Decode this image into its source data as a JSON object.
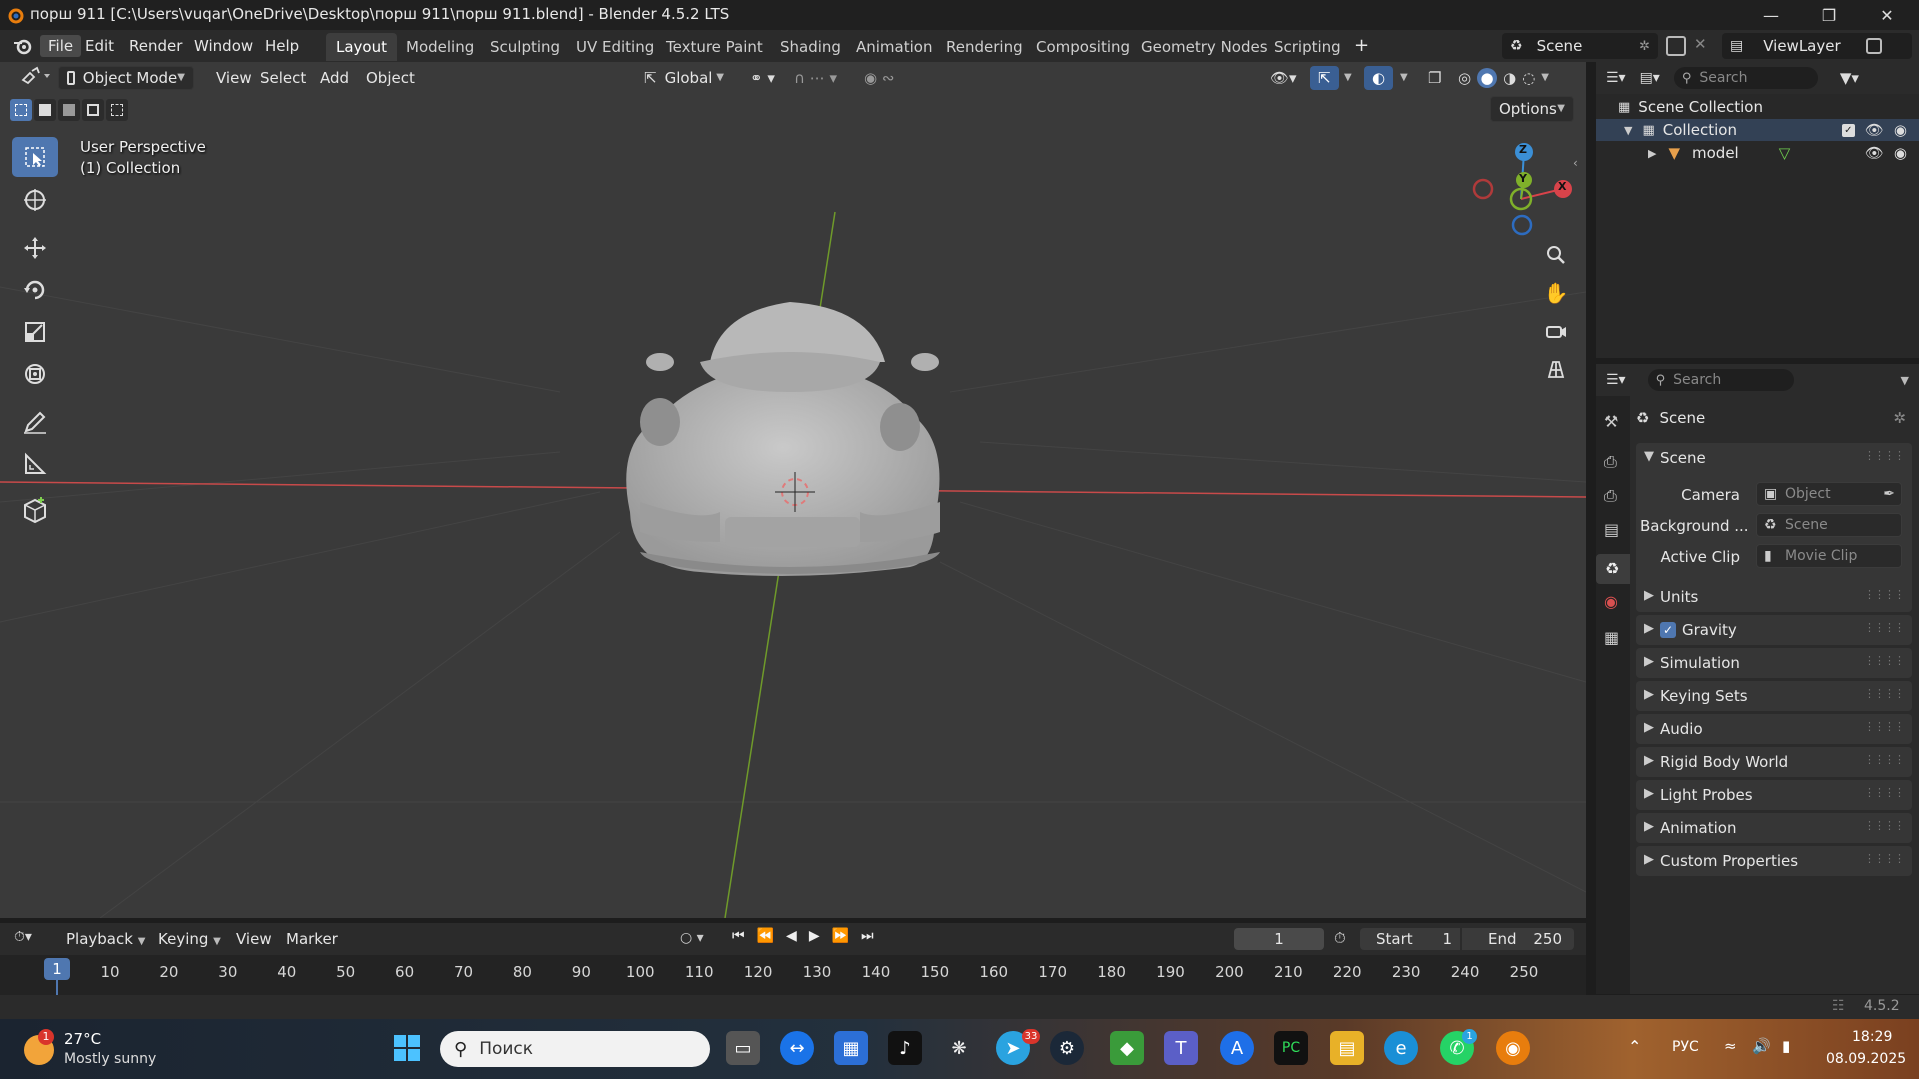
{
  "window": {
    "title": "порш 911 [C:\\Users\\vuqar\\OneDrive\\Desktop\\порш 911\\порш 911.blend] - Blender 4.5.2 LTS"
  },
  "menu": {
    "file": "File",
    "edit": "Edit",
    "render": "Render",
    "window": "Window",
    "help": "Help"
  },
  "workspaces": [
    "Layout",
    "Modeling",
    "Sculpting",
    "UV Editing",
    "Texture Paint",
    "Shading",
    "Animation",
    "Rendering",
    "Compositing",
    "Geometry Nodes",
    "Scripting"
  ],
  "scene_selector": {
    "scene": "Scene",
    "view_layer": "ViewLayer"
  },
  "viewport_header": {
    "mode": "Object Mode",
    "view": "View",
    "select": "Select",
    "add": "Add",
    "object": "Object",
    "orientation": "Global",
    "options": "Options"
  },
  "viewport": {
    "perspective": "User Perspective",
    "collection": "(1) Collection",
    "gizmo": {
      "z": "Z",
      "y": "Y",
      "x": "X"
    }
  },
  "outliner": {
    "search_placeholder": "Search",
    "scene_collection": "Scene Collection",
    "collection": "Collection",
    "object": "model"
  },
  "properties": {
    "search_placeholder": "Search",
    "context": "Scene",
    "section": "Scene",
    "camera_label": "Camera",
    "camera_value": "Object",
    "background_label": "Background ...",
    "background_value": "Scene",
    "active_clip_label": "Active Clip",
    "active_clip_value": "Movie Clip",
    "panels": [
      "Units",
      "Gravity",
      "Simulation",
      "Keying Sets",
      "Audio",
      "Rigid Body World",
      "Light Probes",
      "Animation",
      "Custom Properties"
    ],
    "gravity_enabled": true
  },
  "timeline": {
    "playback": "Playback",
    "keying": "Keying",
    "view": "View",
    "marker": "Marker",
    "current_frame": "1",
    "start_label": "Start",
    "start_value": "1",
    "end_label": "End",
    "end_value": "250",
    "ticks": [
      "1",
      "10",
      "20",
      "30",
      "40",
      "50",
      "60",
      "70",
      "80",
      "90",
      "100",
      "110",
      "120",
      "130",
      "140",
      "150",
      "160",
      "170",
      "180",
      "190",
      "200",
      "210",
      "220",
      "230",
      "240",
      "250"
    ]
  },
  "statusbar": {
    "version": "4.5.2"
  },
  "taskbar": {
    "weather_temp": "27°C",
    "weather_desc": "Mostly sunny",
    "weather_badge": "1",
    "search_placeholder": "Поиск",
    "telegram_badge": "33",
    "whatsapp_badge": "1",
    "lang": "РУС",
    "time": "18:29",
    "date": "08.09.2025"
  },
  "colors": {
    "accent": "#4f77b0",
    "axis_x": "#d8434a",
    "axis_y": "#7fb02a",
    "axis_z": "#3b8fd6"
  }
}
